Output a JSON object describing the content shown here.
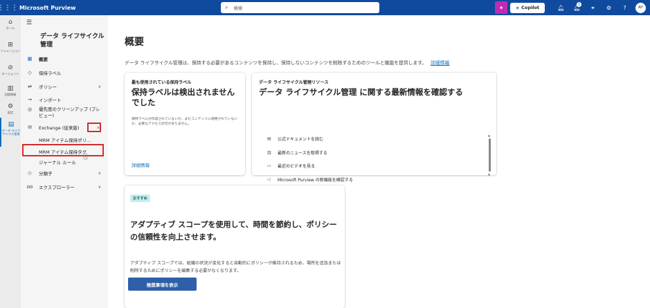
{
  "topbar": {
    "app_name": "Microsoft Purview",
    "search_placeholder": "検索",
    "copilot_label": "Copilot",
    "notification_count": "1",
    "avatar_initials": "AY"
  },
  "rail": {
    "items": [
      {
        "label": "ホーム",
        "icon": "home-icon"
      },
      {
        "label": "ソリューション",
        "icon": "grid-icon"
      },
      {
        "label": "エージェント",
        "icon": "agent-icon"
      },
      {
        "label": "回線情報",
        "icon": "book-icon"
      },
      {
        "label": "設定",
        "icon": "gear-icon"
      },
      {
        "label": "データ ライフサイクル管理",
        "icon": "lifecycle-icon"
      }
    ]
  },
  "nav": {
    "title": "データ ライフサイクル管理",
    "overview": "概要",
    "retention_labels": "保持ラベル",
    "policies": "ポリシー",
    "import": "インポート",
    "priority_cleanup": "優先度のクリーンアップ (プレビュー)",
    "exchange": "Exchange (従来版)",
    "mrm_policies": "MRM アイテム保持ポリ...",
    "mrm_tags": "MRM アイテム保持タグ",
    "journal_rules": "ジャーナル ルール",
    "classifiers": "分類子",
    "explorers": "エクスプローラー"
  },
  "main": {
    "title": "概要",
    "intro": "データ ライフサイクル管理は、保持する必要があるコンテンツを保持し、保持しないコンテンツを削除するためのツールと機能を提供します。",
    "intro_link": "詳細情報",
    "card1": {
      "eyebrow": "最も使用されている保持ラベル",
      "heading": "保持ラベルは検出されませんでした",
      "desc": "保持ラベルが作成されていないか、まだコンテンツに適用されていないか、必要なアクセス許可がありません。",
      "link": "詳細情報"
    },
    "card2": {
      "eyebrow": "データ ライフサイクル管理リソース",
      "heading": "データ ライフサイクル管理 に関する最新情報を確認する",
      "resources": [
        "公式ドキュメントを読む",
        "最新のニュースを取得する",
        "最近のビデオを見る",
        "Microsoft Purview の新機能を確認する"
      ]
    },
    "card3": {
      "badge": "おすすめ",
      "heading": "アダプティブ スコープを使用して、時間を節約し、ポリシーの信頼性を向上させます。",
      "desc": "アダプティブ スコープでは、組織の状況が変化すると自動的にポリシーが維持されるため、場所を追加または削除するためにポリシーを編集する必要がなくなります。",
      "button": "推奨事項を表示"
    }
  },
  "colors": {
    "topbar": "#0f4a9e",
    "accent": "#0f6cbd",
    "highlight_box": "#d42b2b",
    "copilot_pink": "#c02bb4",
    "primary_button": "#2f5fa8"
  }
}
